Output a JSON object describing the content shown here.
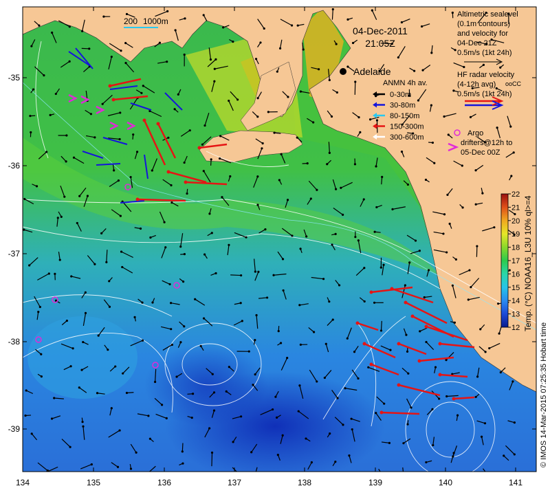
{
  "title": {
    "date": "04-Dec-2011",
    "time": "21:05Z"
  },
  "scale_labels": {
    "a": "200",
    "b": "1000m"
  },
  "city": "Adelaide",
  "altimetry_legend": {
    "line1": "Altimetric sealevel",
    "line2": "(0.1m contours)",
    "line3": "and velocity for",
    "line4": "04-Dec 21Z",
    "line5": "0.5m/s (1kt 24h)"
  },
  "hf_legend": {
    "line1": "HF radar velocity",
    "line2": "(4-12h avg)",
    "line2b": "ooCC",
    "line3": "0.5m/s (1kt 24h)"
  },
  "anmn_legend": {
    "title": "ANMN 4h av.",
    "items": [
      {
        "label": "0-30m",
        "color": "#000000"
      },
      {
        "label": "30-80m",
        "color": "#1414dc"
      },
      {
        "label": "80-150m",
        "color": "#28c8f0"
      },
      {
        "label": "150-300m",
        "color": "#e61414"
      },
      {
        "label": "300-600m",
        "color": "#ffffff"
      }
    ]
  },
  "argo_legend": {
    "line1": "Argo",
    "line2": "drifters@12h to",
    "line3": "05-Dec 00Z"
  },
  "colorbar": {
    "label": "Temp. (°C) NOAA16_L3U 10% ql>=4",
    "ticks": [
      "12",
      "13",
      "14",
      "15",
      "16",
      "17",
      "18",
      "19",
      "20",
      "21",
      "22"
    ]
  },
  "x_axis": {
    "ticks": [
      "134",
      "135",
      "136",
      "137",
      "138",
      "139",
      "140",
      "141"
    ]
  },
  "y_axis": {
    "ticks": [
      "-35",
      "-36",
      "-37",
      "-38",
      "-39"
    ]
  },
  "credit": "© IMOS 14-Mar-2015 07:25:35 Hobart time",
  "colors": {
    "land": "#f6c795",
    "argo": "#e02ad8"
  }
}
